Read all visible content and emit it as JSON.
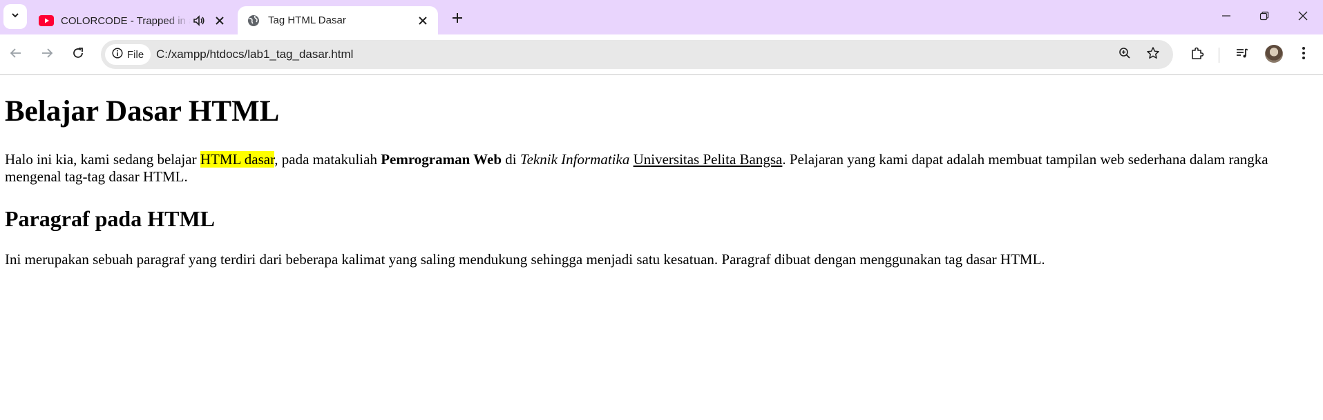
{
  "browser": {
    "tabs": [
      {
        "title": "COLORCODE - Trapped in a",
        "favicon": "youtube-icon",
        "audio": true,
        "active": false
      },
      {
        "title": "Tag HTML Dasar",
        "favicon": "globe-icon",
        "active": true
      }
    ],
    "address": {
      "chip_label": "File",
      "url": "C:/xampp/htdocs/lab1_tag_dasar.html"
    },
    "accent": "#e9d5fd"
  },
  "page": {
    "heading": "Belajar Dasar HTML",
    "intro": {
      "t1": "Halo ini kia, kami sedang belajar ",
      "highlight": "HTML dasar",
      "t2": ", pada matakuliah ",
      "bold": "Pemrograman Web",
      "t3": " di ",
      "italic": "Teknik Informatika",
      "t4": " ",
      "link": "Universitas Pelita Bangsa",
      "t5": ". Pelajaran yang kami dapat adalah membuat tampilan web sederhana dalam rangka mengenal tag-tag dasar HTML."
    },
    "subheading": "Paragraf pada HTML",
    "paragraph": "Ini merupakan sebuah paragraf yang terdiri dari beberapa kalimat yang saling mendukung sehingga menjadi satu kesatuan. Paragraf dibuat dengan menggunakan tag dasar HTML."
  }
}
